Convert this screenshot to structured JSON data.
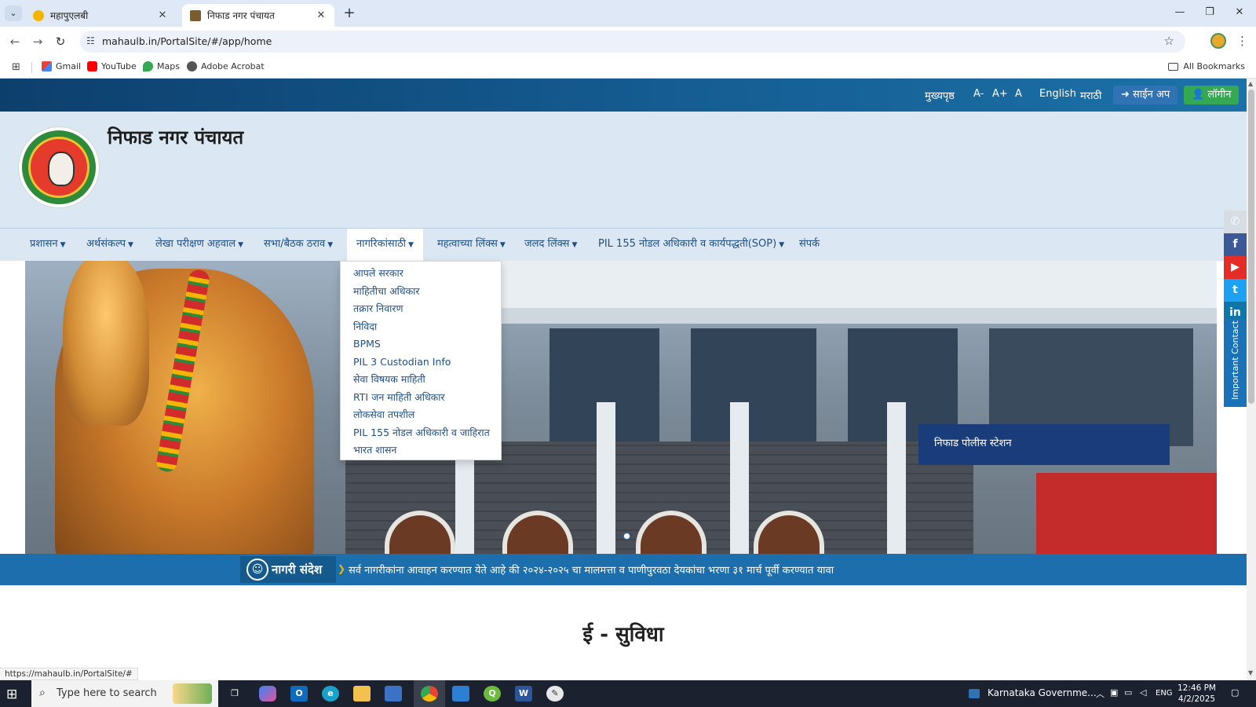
{
  "browser": {
    "tabs": [
      {
        "title": "महापुएलबी",
        "active": false
      },
      {
        "title": "निफाड नगर पंचायत",
        "active": true
      }
    ],
    "url": "mahaulb.in/PortalSite/#/app/home",
    "bookmarks": [
      "Gmail",
      "YouTube",
      "Maps",
      "Adobe Acrobat"
    ],
    "all_bookmarks": "All Bookmarks",
    "status_url": "https://mahaulb.in/PortalSite/#"
  },
  "topbar": {
    "home": "मुख्यपृष्ठ",
    "font_minus": "A-",
    "font_plus": "A+",
    "font_normal": "A",
    "lang_en": "English",
    "lang_mr": "मराठी",
    "signup": "साईन अप",
    "login": "लॉगीन"
  },
  "site": {
    "title": "निफाड नगर पंचायत"
  },
  "nav": [
    "प्रशासन",
    "अर्थसंकल्प",
    "लेखा परीक्षण अहवाल",
    "सभा/बैठक ठराव",
    "नागरिकांसाठी",
    "महत्वाच्या लिंक्स",
    "जलद लिंक्स",
    "PIL 155 नोडल अधिकारी व कार्यपद्धती(SOP)",
    "संपर्क"
  ],
  "dropdown": [
    "आपले सरकार",
    "माहितीचा अधिकार",
    "तक्रार निवारण",
    "निविदा",
    "BPMS",
    "PIL 3 Custodian Info",
    "सेवा विषयक माहिती",
    "RTI जन माहिती अधिकार",
    "लोकसेवा तपशील",
    "PIL 155 नोडल अधिकारी व जाहिरात",
    "भारत शासन"
  ],
  "hero": {
    "sign_text": "निफाड पोलीस स्टेशन"
  },
  "sidebar": {
    "important_contact": "Important Contact"
  },
  "notice": {
    "label": "नागरी संदेश",
    "text": "सर्व नागरीकांना आवाहन करण्यात येते आहे की २०२४-२०२५ चा मालमत्ता व पाणीपुरवठा देयकांचा भरणा ३१ मार्च पूर्वी करण्यात यावा"
  },
  "section": {
    "title": "ई - सुविधा"
  },
  "taskbar": {
    "search_placeholder": "Type here to search",
    "weather": "Karnataka Governme...",
    "lang": "ENG",
    "time": "12:46 PM",
    "date": "4/2/2025"
  },
  "colors": {
    "top_strip": "#155d93",
    "header_bg": "#dbe7f2",
    "nav_text": "#1f4f86",
    "notice_bg": "#1c6fac",
    "login_btn": "#34a853",
    "signup_btn": "#2f73b5"
  }
}
